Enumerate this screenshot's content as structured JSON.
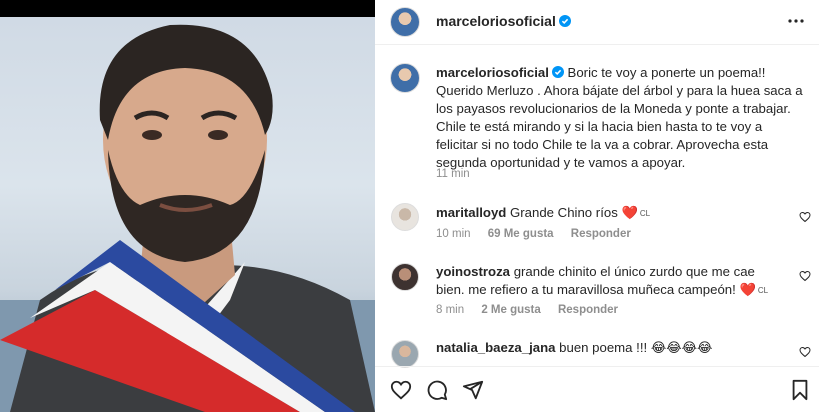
{
  "post": {
    "author": "marceloriosoficial",
    "caption_body": "Boric te voy a ponerte un poema!! Querido Merluzo . Ahora bájate del árbol y para la huea saca a los payasos revolucionarios de la Moneda y ponte a trabajar. Chile te está mirando y si la hacia bien hasta to te voy a felicitar si no todo Chile te la va a cobrar. Aprovecha esta segunda oportunidad y te vamos a apoyar.",
    "caption_time": "11 min"
  },
  "comments": [
    {
      "user": "maritalloyd",
      "text": "Grande Chino ríos ❤️",
      "flag": "CL",
      "time": "10 min",
      "likes": "69 Me gusta",
      "reply": "Responder"
    },
    {
      "user": "yoinostroza",
      "text": "grande chinito el único zurdo que me cae bien. me refiero a tu maravillosa muñeca campeón! ❤️",
      "flag": "CL",
      "time": "8 min",
      "likes": "2 Me gusta",
      "reply": "Responder"
    },
    {
      "user": "natalia_baeza_jana",
      "text": "buen poema !!! 😂😂😂😂"
    }
  ],
  "icons": {
    "more": "more-horizontal-icon",
    "verified": "verified-badge-icon",
    "like": "heart-icon",
    "comment": "comment-icon",
    "share": "send-icon",
    "save": "bookmark-icon"
  },
  "colors": {
    "verified_blue": "#0095f6",
    "secondary_text": "#8e8e8e",
    "heart_red": "#e0245e"
  }
}
